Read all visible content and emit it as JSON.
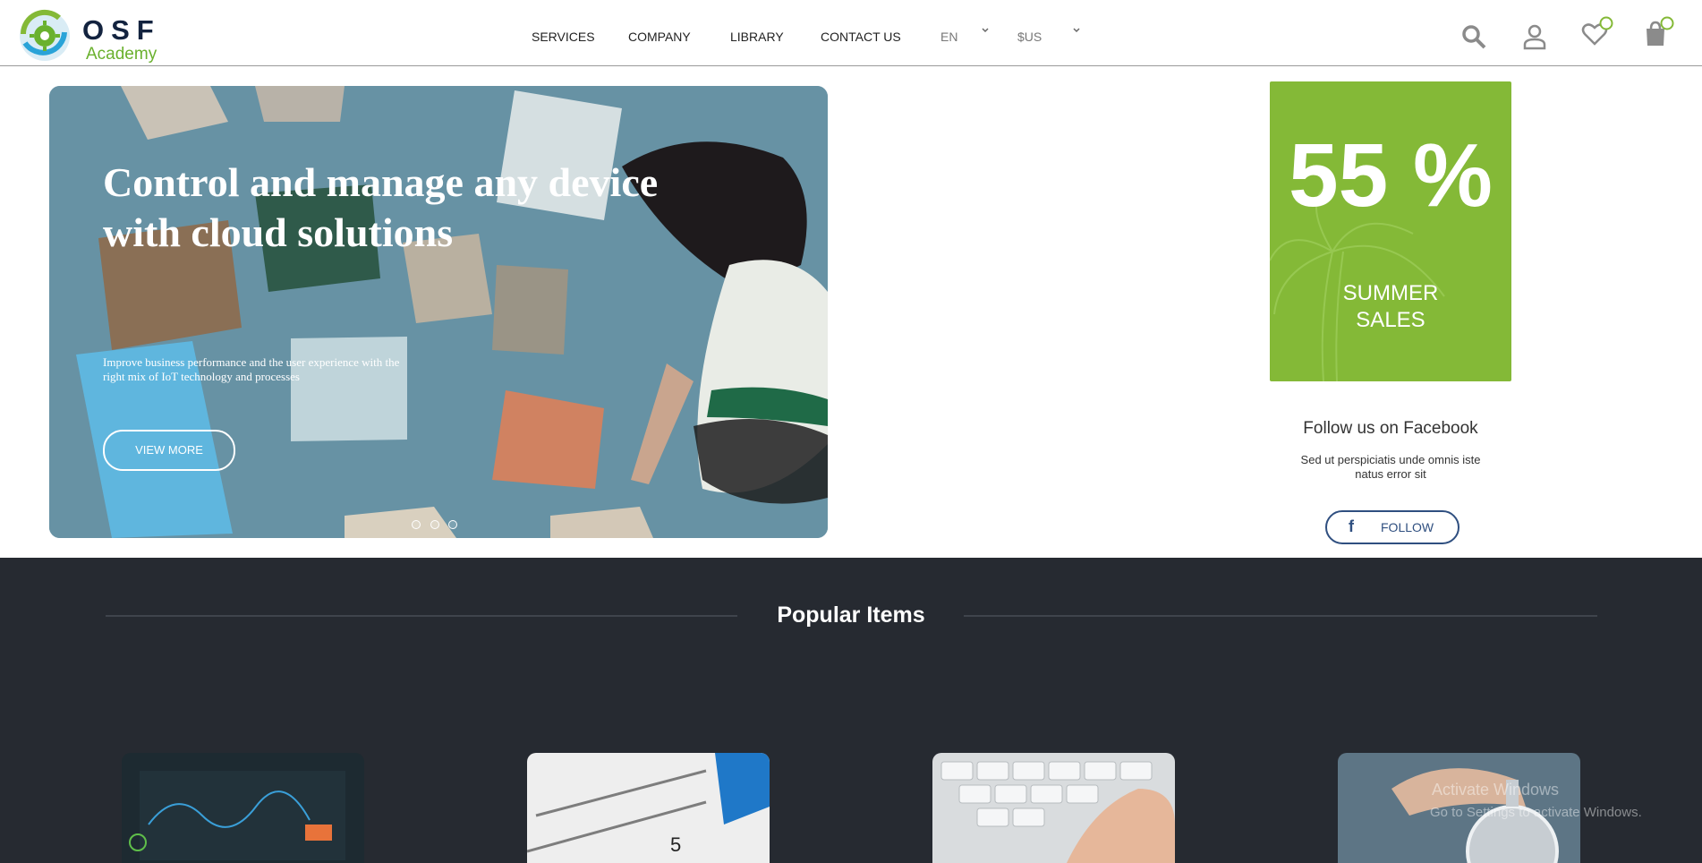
{
  "logo": {
    "brand": "OSF",
    "sub": "Academy"
  },
  "nav": {
    "items": [
      "SERVICES",
      "COMPANY",
      "LIBRARY",
      "CONTACT US"
    ]
  },
  "language": {
    "selected": "EN"
  },
  "currency": {
    "selected": "$US"
  },
  "header_icons": [
    "search-icon",
    "user-icon",
    "heart-icon",
    "bag-icon"
  ],
  "hero": {
    "title": "Control and manage any device with cloud solutions",
    "description": "Improve business performance and the user experience with the right mix of IoT technology and processes",
    "button": "VIEW MORE",
    "slides": 3
  },
  "promo": {
    "percent": "55 %",
    "label_line1": "SUMMER",
    "label_line2": "SALES"
  },
  "facebook": {
    "title": "Follow us on Facebook",
    "text": "Sed ut perspiciatis unde omnis iste natus error sit",
    "button": "FOLLOW"
  },
  "popular": {
    "title": "Popular Items"
  },
  "watermark": {
    "line1": "Activate Windows",
    "line2": "Go to Settings to activate Windows."
  },
  "colors": {
    "accent": "#84b937",
    "dark": "#262a31",
    "navy": "#13233f",
    "fb": "#2f4f80"
  }
}
